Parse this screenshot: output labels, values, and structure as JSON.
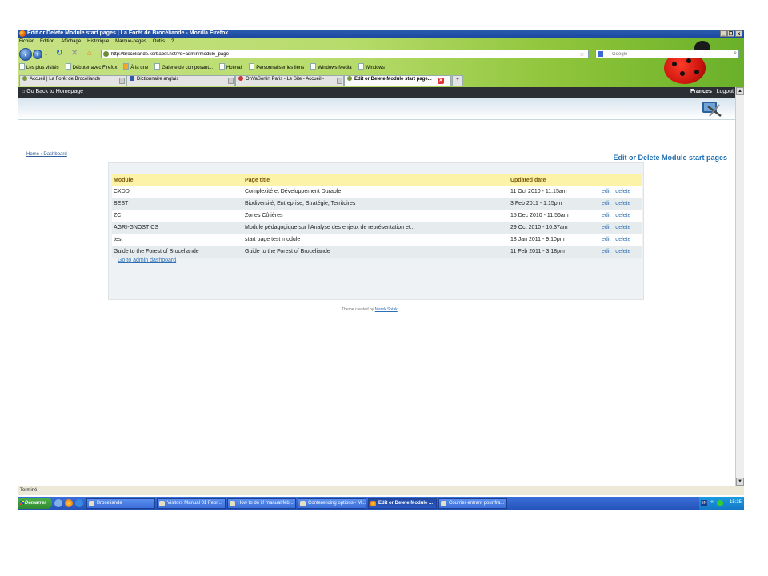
{
  "window": {
    "title": "Edit or Delete Module start pages | La Forêt de Brocéliande - Mozilla Firefox",
    "controls": [
      "_",
      "❐",
      "x"
    ]
  },
  "menu": [
    "Fichier",
    "Édition",
    "Affichage",
    "Historique",
    "Marque-pages",
    "Outils",
    "?"
  ],
  "url": "http://broceliande.kerbabel.net/?q=admin/module_page",
  "search": {
    "placeholder": "Google"
  },
  "bookmarks": [
    "Les plus visités",
    "Débuter avec Firefox",
    "À la une",
    "Galerie de composant...",
    "Hotmail",
    "Personnaliser les liens",
    "Windows Media",
    "Windows"
  ],
  "tabs": [
    {
      "label": "Accueil | La Forêt de Brocéliande"
    },
    {
      "label": "Dictionnaire anglais"
    },
    {
      "label": "OnVaSortir! Paris - Le Site - Accueil -"
    },
    {
      "label": "Edit or Delete Module start page...",
      "active": true
    }
  ],
  "site": {
    "home_link": "Go Back to Homepage",
    "user": "Frances",
    "sep": " | ",
    "logout": "Logout",
    "breadcrumb": {
      "home": "Home",
      "sep": " › ",
      "dashboard": "Dashboard"
    },
    "page_title": "Edit or Delete Module start pages"
  },
  "table": {
    "headers": {
      "module": "Module",
      "page_title": "Page title",
      "updated": "Updated date"
    },
    "action_edit": "edit",
    "action_delete": "delete",
    "rows": [
      {
        "module": "CXDD",
        "title": "Complexité et Développement Durable",
        "updated": "11 Oct 2010 - 11:15am"
      },
      {
        "module": "BEST",
        "title": "Biodiversité, Entreprise, Stratégie, Territoires",
        "updated": "3 Feb 2011 - 1:15pm"
      },
      {
        "module": "ZC",
        "title": "Zones Côtières",
        "updated": "15 Dec 2010 - 11:56am"
      },
      {
        "module": "AGRI-GNOSTICS",
        "title": "Module pédagogique sur l'Analyse des enjeux de représentation et...",
        "updated": "29 Oct 2010 - 10:37am"
      },
      {
        "module": "test",
        "title": "start page test module",
        "updated": "18 Jan 2011 - 9:10pm"
      },
      {
        "module": "Guide to the Forest of Broceliande",
        "title": "Guide to the Forest of Broceliande",
        "updated": "11 Feb 2011 - 3:18pm"
      }
    ]
  },
  "admin_link": "Go to admin dashboard",
  "credit": {
    "text": "Theme created by ",
    "author": "Marek Sotak"
  },
  "status": "Terminé",
  "taskbar": {
    "start": "Démarrer",
    "tasks": [
      {
        "label": "Broceliande"
      },
      {
        "label": "Visitors Manual 01 Febr..."
      },
      {
        "label": "How to do it! manual feb..."
      },
      {
        "label": "Conferencing options - M..."
      },
      {
        "label": "Edit or Delete Module ...",
        "active": true
      },
      {
        "label": "Courrier entrant pour fra..."
      }
    ],
    "lang": "EN",
    "clock": "15:35"
  },
  "colors": {
    "accent": "#1f6fb2",
    "header_bar": "#2c2f33",
    "table_header": "#fcf3a8"
  }
}
